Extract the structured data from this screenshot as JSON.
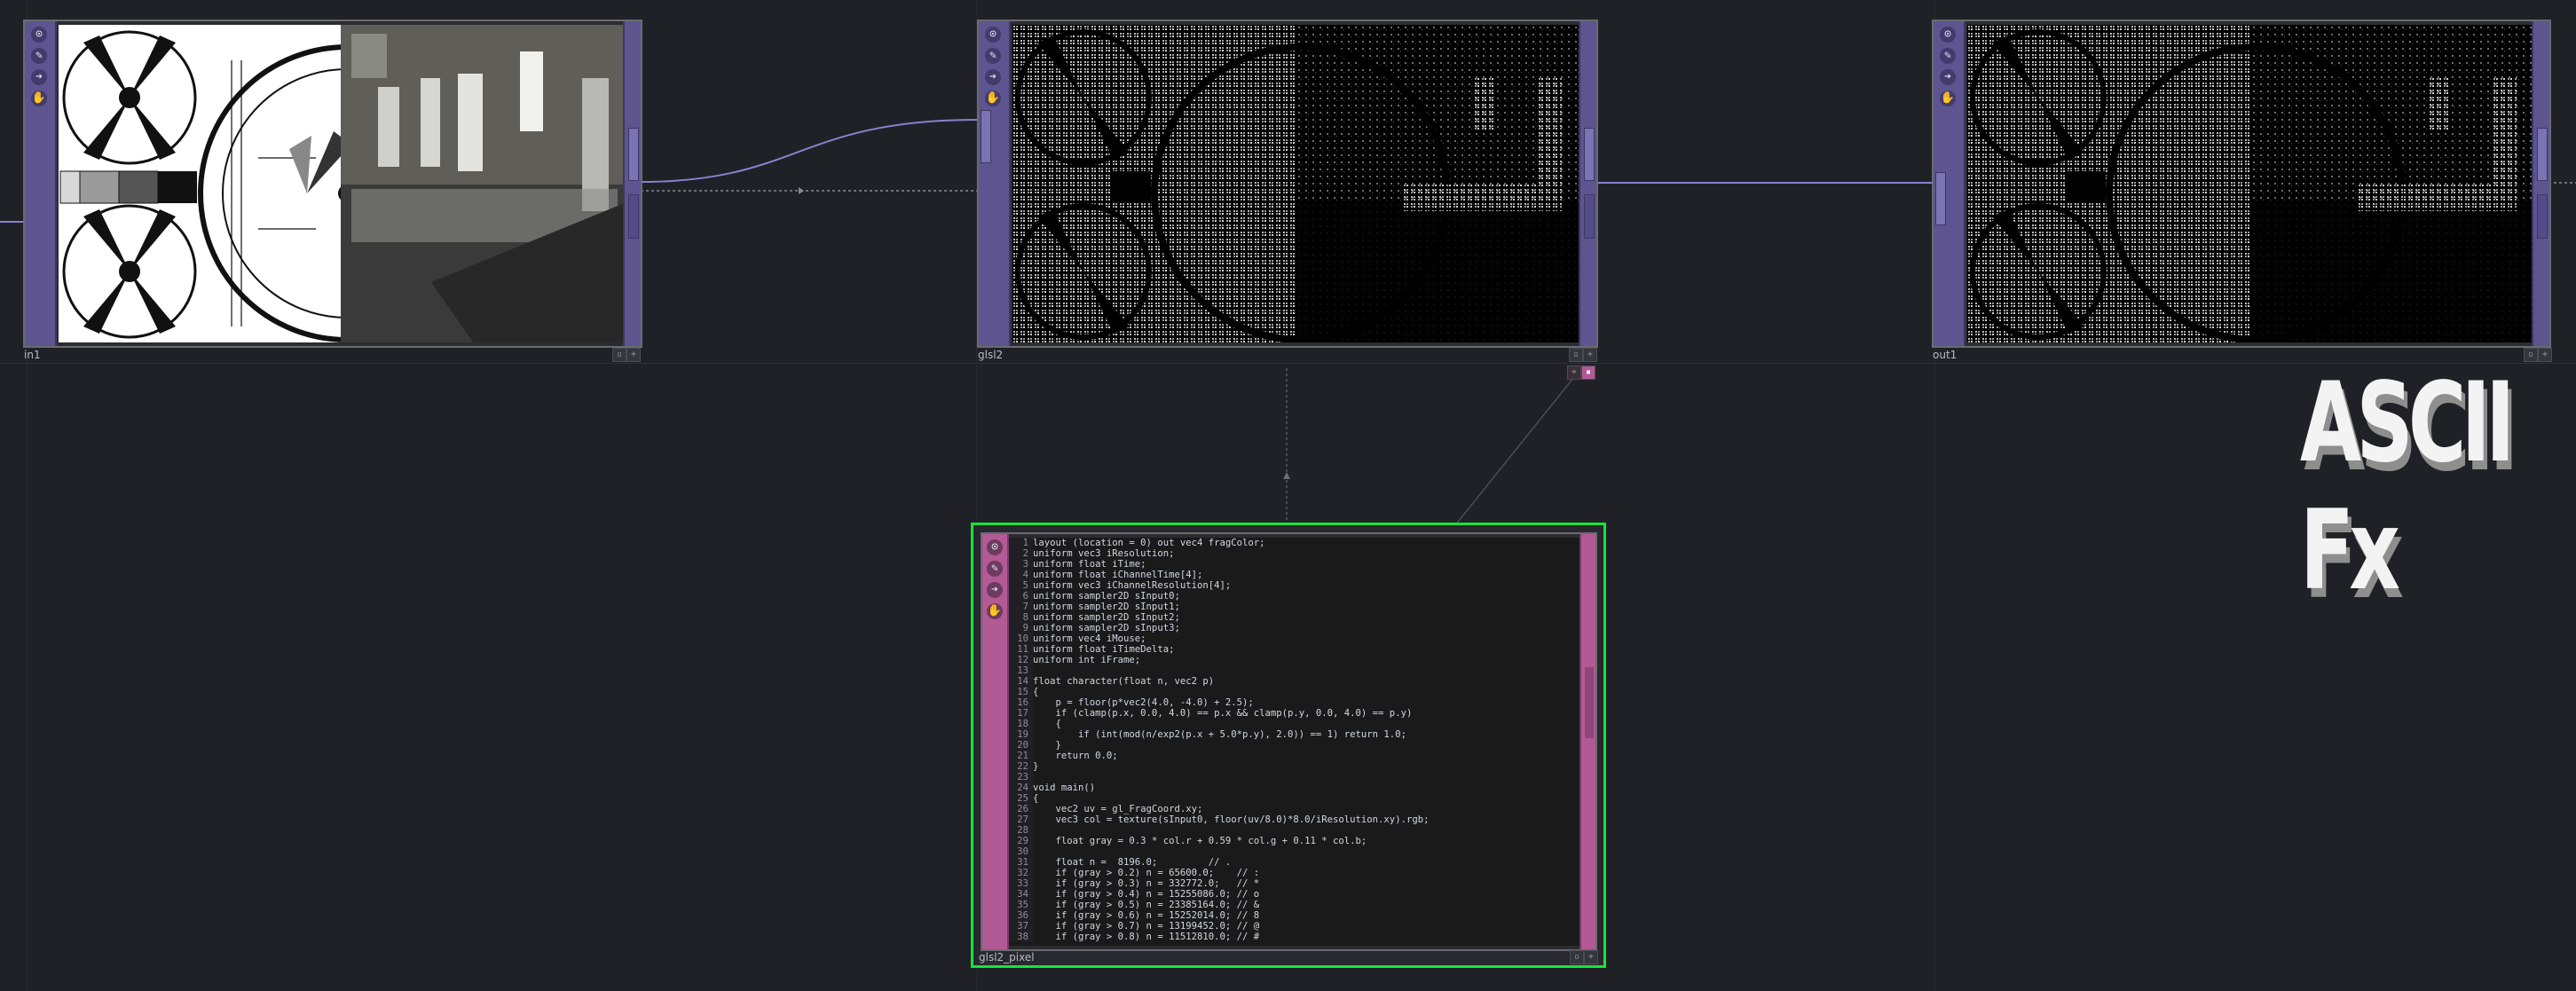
{
  "nodes": [
    {
      "name": "in1",
      "accent": "#5d5490"
    },
    {
      "name": "glsl2",
      "accent": "#5d5490"
    },
    {
      "name": "out1",
      "accent": "#5d5490"
    },
    {
      "name": "glsl2_pixel",
      "accent": "#b25a95",
      "selected_border": "#19e33a"
    }
  ],
  "sidebar_icons": [
    "target-icon",
    "pencil-icon",
    "arrow-right-icon",
    "hand-icon"
  ],
  "title_art": "ASCII Fx",
  "code_lines": [
    "layout (location = 0) out vec4 fragColor;",
    "uniform vec3 iResolution;",
    "uniform float iTime;",
    "uniform float iChannelTime[4];",
    "uniform vec3 iChannelResolution[4];",
    "uniform sampler2D sInput0;",
    "uniform sampler2D sInput1;",
    "uniform sampler2D sInput2;",
    "uniform sampler2D sInput3;",
    "uniform vec4 iMouse;",
    "uniform float iTimeDelta;",
    "uniform int iFrame;",
    "",
    "float character(float n, vec2 p)",
    "{",
    "    p = floor(p*vec2(4.0, -4.0) + 2.5);",
    "    if (clamp(p.x, 0.0, 4.0) == p.x && clamp(p.y, 0.0, 4.0) == p.y)",
    "    {",
    "        if (int(mod(n/exp2(p.x + 5.0*p.y), 2.0)) == 1) return 1.0;",
    "    }",
    "    return 0.0;",
    "}",
    "",
    "void main()",
    "{",
    "    vec2 uv = gl_FragCoord.xy;",
    "    vec3 col = texture(sInput0, floor(uv/8.0)*8.0/iResolution.xy).rgb;",
    "",
    "    float gray = 0.3 * col.r + 0.59 * col.g + 0.11 * col.b;",
    "",
    "    float n =  8196.0;         // .",
    "    if (gray > 0.2) n = 65600.0;    // :",
    "    if (gray > 0.3) n = 332772.0;   // *",
    "    if (gray > 0.4) n = 15255086.0; // o",
    "    if (gray > 0.5) n = 23385164.0; // &",
    "    if (gray > 0.6) n = 15252014.0; // 8",
    "    if (gray > 0.7) n = 13199452.0; // @",
    "    if (gray > 0.8) n = 11512810.0; // #"
  ]
}
